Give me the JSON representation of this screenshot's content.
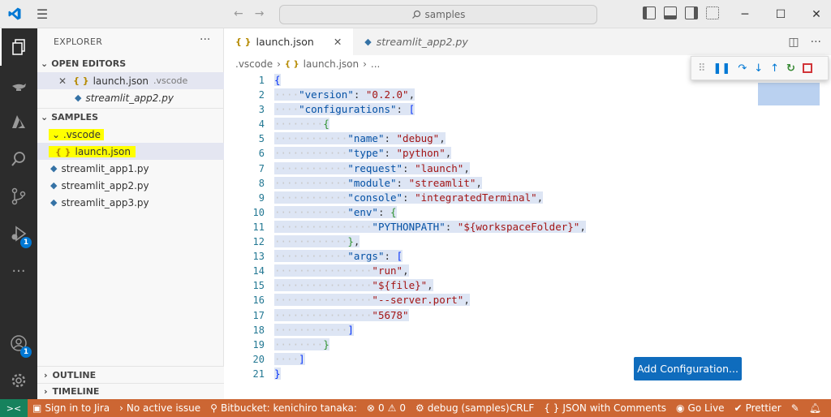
{
  "titlebar": {
    "search_text": "samples",
    "nav_back": "←",
    "nav_forward": "→",
    "menu_icon": "☰",
    "win_min": "─",
    "win_max": "☐",
    "win_close": "✕"
  },
  "sidebar": {
    "title": "EXPLORER",
    "more": "···",
    "open_editors_header": "OPEN EDITORS",
    "open_editors": [
      {
        "name": "launch.json",
        "path": ".vscode",
        "icon": "json-icon"
      },
      {
        "name": "streamlit_app2.py",
        "icon": "python-icon"
      }
    ],
    "folder_header": "SAMPLES",
    "tree": [
      {
        "label": ".vscode",
        "type": "folder"
      },
      {
        "label": "launch.json",
        "type": "json"
      },
      {
        "label": "streamlit_app1.py",
        "type": "python"
      },
      {
        "label": "streamlit_app2.py",
        "type": "python"
      },
      {
        "label": "streamlit_app3.py",
        "type": "python"
      }
    ],
    "outline": "OUTLINE",
    "timeline": "TIMELINE"
  },
  "activity": {
    "run_badge": "1",
    "account_badge": "1"
  },
  "tabs": [
    {
      "label": "launch.json",
      "active": true
    },
    {
      "label": "streamlit_app2.py",
      "active": false
    }
  ],
  "breadcrumbs": [
    ".vscode",
    "launch.json",
    "..."
  ],
  "editor": {
    "line_numbers": [
      "1",
      "2",
      "3",
      "4",
      "5",
      "6",
      "7",
      "8",
      "9",
      "10",
      "11",
      "12",
      "13",
      "14",
      "15",
      "16",
      "17",
      "18",
      "19",
      "20",
      "21"
    ],
    "lines": [
      "{",
      "    \"version\": \"0.2.0\",",
      "    \"configurations\": [",
      "        {",
      "            \"name\": \"debug\",",
      "            \"type\": \"python\",",
      "            \"request\": \"launch\",",
      "            \"module\": \"streamlit\",",
      "            \"console\": \"integratedTerminal\",",
      "            \"env\": {",
      "                \"PYTHONPATH\": \"${workspaceFolder}\",",
      "            },",
      "            \"args\": [",
      "                \"run\",",
      "                \"${file}\",",
      "                \"--server.port\",",
      "                \"5678\"",
      "            ]",
      "        }",
      "    ]",
      "}"
    ],
    "add_configuration_label": "Add Configuration..."
  },
  "statusbar": {
    "remote": "><",
    "jira": "Sign in to Jira",
    "issue": "No active issue",
    "bitbucket": "Bitbucket: kenichiro tanaka:",
    "errors": "0",
    "warnings": "0",
    "debug": "debug (samples)",
    "eol": "CRLF",
    "language": "JSON with Comments",
    "golive": "Go Live",
    "prettier": "Prettier"
  },
  "colors": {
    "status_bar": "#cc6633",
    "remote": "#16825d",
    "accent": "#0f6cbd",
    "highlight": "#ffff00"
  }
}
